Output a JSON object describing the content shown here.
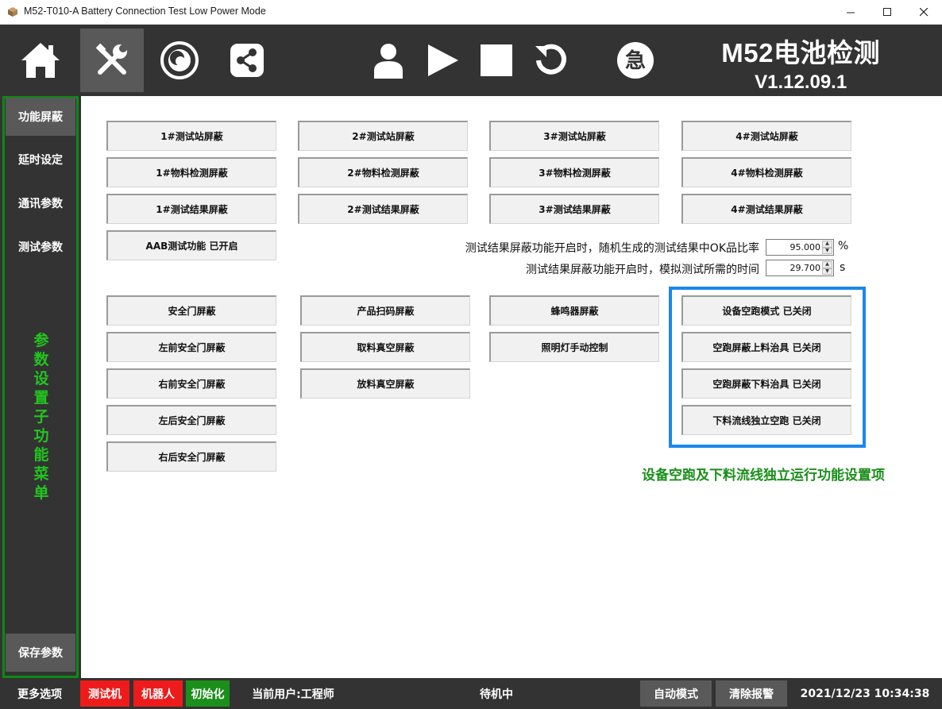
{
  "window": {
    "title": "M52-T010-A Battery Connection Test Low Power Mode",
    "minimize_label": "—",
    "maximize_label": "☐",
    "close_label": "✕"
  },
  "toolbar": {
    "buttons": [
      {
        "icon": "home-icon"
      },
      {
        "icon": "tools-icon",
        "active": true
      },
      {
        "icon": "camera-lens-icon"
      },
      {
        "icon": "share-icon"
      },
      {
        "icon": "user-icon"
      },
      {
        "icon": "play-icon"
      },
      {
        "icon": "stop-icon"
      },
      {
        "icon": "reset-icon"
      },
      {
        "icon": "emergency-icon",
        "label": "急"
      }
    ],
    "brand_name": "M52电池检测",
    "version": "V1.12.09.1"
  },
  "sidebar": {
    "items": [
      {
        "label": "功能屏蔽",
        "active": true
      },
      {
        "label": "延时设定"
      },
      {
        "label": "通讯参数"
      },
      {
        "label": "测试参数"
      }
    ],
    "vertical_label": [
      "参",
      "数",
      "设",
      "置",
      "子",
      "功",
      "能",
      "菜",
      "单"
    ],
    "save_label": "保存参数"
  },
  "main": {
    "station_buttons": [
      [
        "1#测试站屏蔽",
        "2#测试站屏蔽",
        "3#测试站屏蔽",
        "4#测试站屏蔽"
      ],
      [
        "1#物料检测屏蔽",
        "2#物料检测屏蔽",
        "3#物料检测屏蔽",
        "4#物料检测屏蔽"
      ],
      [
        "1#测试结果屏蔽",
        "2#测试结果屏蔽",
        "3#测试结果屏蔽",
        "4#测试结果屏蔽"
      ]
    ],
    "aab_button": "AAB测试功能 已开启",
    "ok_ratio": {
      "label": "测试结果屏蔽功能开启时，随机生成的测试结果中OK品比率",
      "value": "95.000",
      "unit": "%"
    },
    "sim_time": {
      "label": "测试结果屏蔽功能开启时，模拟测试所需的时间",
      "value": "29.700",
      "unit": "s"
    },
    "col1": [
      "安全门屏蔽",
      "左前安全门屏蔽",
      "右前安全门屏蔽",
      "左后安全门屏蔽",
      "右后安全门屏蔽"
    ],
    "col2": [
      "产品扫码屏蔽",
      "取料真空屏蔽",
      "放料真空屏蔽"
    ],
    "col3": [
      "蜂鸣器屏蔽",
      "照明灯手动控制"
    ],
    "col4": [
      "设备空跑模式 已关闭",
      "空跑屏蔽上料治具 已关闭",
      "空跑屏蔽下料治具 已关闭",
      "下料流线独立空跑 已关闭"
    ],
    "note": "设备空跑及下料流线独立运行功能设置项",
    "note_color": "#1a8f1a",
    "highlight_color": "#1a88ec"
  },
  "status": {
    "more_options": "更多选项",
    "tester": "测试机",
    "robot": "机器人",
    "init": "初始化",
    "current_user": "当前用户:工程师",
    "state": "待机中",
    "auto_mode": "自动模式",
    "clear_alarm": "清除报警",
    "datetime": "2021/12/23 10:34:38"
  }
}
